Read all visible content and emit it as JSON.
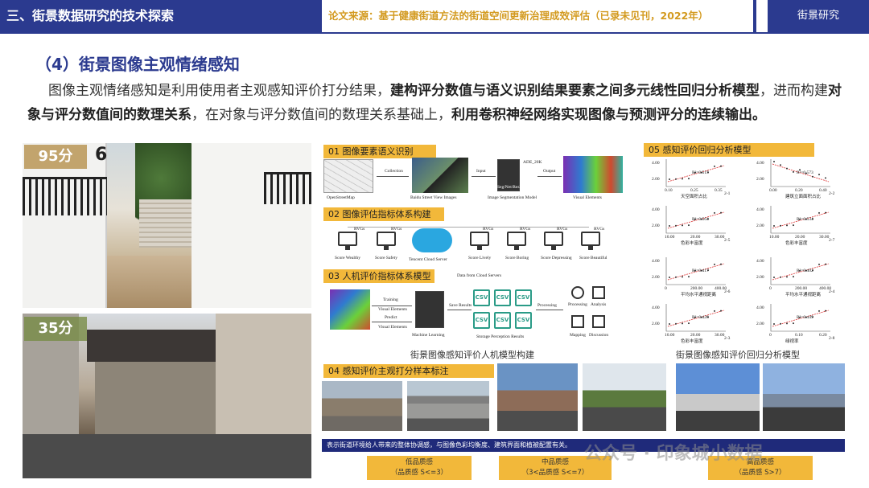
{
  "header": {
    "section": "三、街景数据研究的技术探索",
    "source": "论文来源：基于健康街道方法的街道空间更新治理成效评估（已录未见刊，2022年）",
    "tag": "街景研究"
  },
  "section_title": "（4）街景图像主观情绪感知",
  "paragraph": {
    "p1": "图像主观情绪感知是利用使用者主观感知评价打分结果，",
    "b1": "建构评分数值与语义识别结果要素之间多元线性回归分析模型",
    "p2": "，进而构建",
    "b2": "对象与评分数值间的数理关系",
    "p3": "，在对象与评分数值间的数理关系基础上，",
    "b3": "利用卷积神经网络实现图像与预测评分的连续输出。"
  },
  "photos": {
    "score_high": "95分",
    "number_tag": "6",
    "score_low": "35分"
  },
  "panel01": {
    "title": "01 图像要素语义识别",
    "labels": [
      "OpenStreetMap",
      "Baidu Street View Images",
      "Image Segmentation Model",
      "Visual Elements"
    ],
    "arrows": [
      "Collection",
      "Input",
      "Output"
    ],
    "model": "Seg/Net/ResNet",
    "model2": "ADE_20K"
  },
  "panel02": {
    "title": "02 图像评估指标体系构建",
    "left_labels": [
      "Score Wealthy",
      "Score Safety"
    ],
    "center": "Tencent Cloud Server",
    "right_labels": [
      "Score Lively",
      "Score Boring",
      "Score Depressing",
      "Score Beautiful"
    ],
    "rating": "RVGs"
  },
  "panel03": {
    "title": "03 人机评价指标体系模型",
    "labels": [
      "Training",
      "Visual Elements",
      "Predict",
      "Visual Elements",
      "Machine Learning",
      "Save Results",
      "Storage Perception Results",
      "Processing",
      "Processing",
      "Analysis",
      "Mapping",
      "Discussion"
    ],
    "csv": "CSV",
    "server": "Data from Cloud Servers"
  },
  "caption_left": "街景图像感知评价人机模型构建",
  "panel05": {
    "title": "05 感知评价回归分析模型",
    "ylabel": "感知",
    "plots": [
      {
        "id": "2-1",
        "xlabel": "天空面积占比",
        "r2": "R²=0.515",
        "ticks": [
          "0.10",
          "0.25",
          "0.35"
        ]
      },
      {
        "id": "2-2",
        "xlabel": "建筑立面面积占比",
        "r2": "R²=0.573",
        "ticks": [
          "0.00",
          "0.20",
          "0.40"
        ]
      },
      {
        "id": "2-5",
        "xlabel": "色彩丰富度",
        "r2": "R²=0.564",
        "ticks": [
          "10.00",
          "20.00",
          "30.00"
        ]
      },
      {
        "id": "2-7",
        "xlabel": "色彩丰富度",
        "r2": "R²=0.534",
        "ticks": [
          "10.00",
          "20.00",
          "30.00"
        ]
      },
      {
        "id": "2-6",
        "xlabel": "平均水平通视距离",
        "r2": "R²=0.417",
        "ticks": [
          "0",
          "200.00",
          "400.00"
        ]
      },
      {
        "id": "2-4",
        "xlabel": "平均水平通视距离",
        "r2": "R²=0.402",
        "ticks": [
          "0",
          "200.00",
          "400.00"
        ]
      },
      {
        "id": "2-3",
        "xlabel": "色彩丰富度",
        "r2": "R²=0.426",
        "ticks": [
          "10.00",
          "20.00",
          "30.00"
        ]
      },
      {
        "id": "2-8",
        "xlabel": "绿视率",
        "r2": "R²=0.449",
        "ticks": [
          "0",
          "0.10",
          "0.20"
        ]
      }
    ],
    "y_ticks": [
      "1.00",
      "2.00",
      "3.00",
      "4.00",
      "5.00"
    ],
    "extra_id": "2-9"
  },
  "caption_right": "街景图像感知评价回归分析模型",
  "panel04": {
    "title": "04 感知评价主观打分样本标注"
  },
  "strip": "表示街道环境给人带来的整体协调感，与图像色彩均衡度、建筑界面和植被配置有关。",
  "ranks": [
    {
      "name": "低品质感",
      "range": "（品质感 S<=3）"
    },
    {
      "name": "中品质感",
      "range": "（3<品质感 S<=7）"
    },
    {
      "name": "高品质感",
      "range": "（品质感 S>7）"
    }
  ],
  "watermark": "公众号 · 印象城小数据",
  "colors": {
    "navy": "#2b3a8f",
    "gold": "#f2b83a",
    "teal": "#2a9b87"
  }
}
